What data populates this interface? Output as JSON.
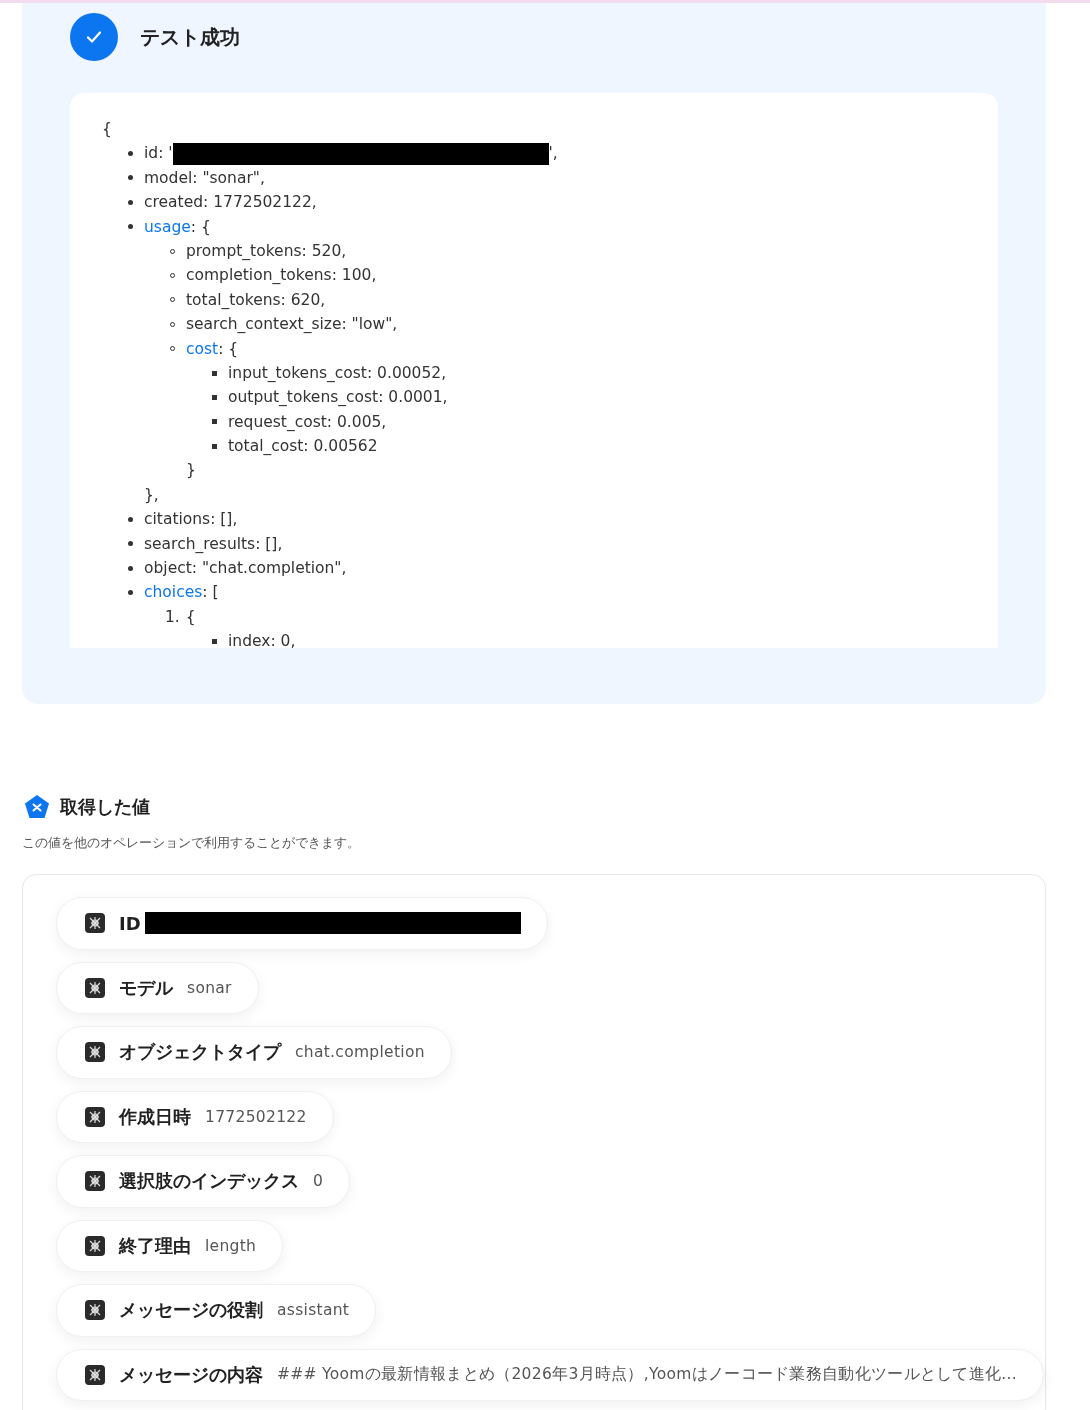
{
  "result": {
    "title": "テスト成功",
    "success": true,
    "code": {
      "open": "{",
      "items": [
        {
          "text": "id: '",
          "redacted": true,
          "after": "',"
        },
        {
          "text": "model: \"sonar\","
        },
        {
          "text": "created: 1772502122,"
        },
        {
          "key": "usage",
          "text": ": {",
          "close": "},",
          "children": [
            {
              "text": "prompt_tokens: 520,"
            },
            {
              "text": "completion_tokens: 100,"
            },
            {
              "text": "total_tokens: 620,"
            },
            {
              "text": "search_context_size: \"low\","
            },
            {
              "key": "cost",
              "text": ": {",
              "close": "}",
              "children": [
                {
                  "text": "input_tokens_cost: 0.00052,"
                },
                {
                  "text": "output_tokens_cost: 0.0001,"
                },
                {
                  "text": "request_cost: 0.005,"
                },
                {
                  "text": "total_cost: 0.00562"
                }
              ]
            }
          ]
        },
        {
          "text": "citations: [],"
        },
        {
          "text": "search_results: [],"
        },
        {
          "text": "object: \"chat.completion\","
        },
        {
          "key": "choices",
          "text": ": [",
          "ordered_children": [
            {
              "marker": "1.",
              "text": "{",
              "children": [
                {
                  "text": "index: 0,"
                }
              ]
            }
          ]
        }
      ]
    }
  },
  "values": {
    "title": "取得した値",
    "description": "この値を他のオペレーションで利用することができます。",
    "chips": [
      {
        "label": "ID",
        "redacted": true
      },
      {
        "label": "モデル",
        "value": "sonar"
      },
      {
        "label": "オブジェクトタイプ",
        "value": "chat.completion"
      },
      {
        "label": "作成日時",
        "value": "1772502122"
      },
      {
        "label": "選択肢のインデックス",
        "value": "0"
      },
      {
        "label": "終了理由",
        "value": "length"
      },
      {
        "label": "メッセージの役割",
        "value": "assistant"
      },
      {
        "label": "メッセージの内容",
        "value": "### Yoomの最新情報まとめ（2026年3月時点）,Yoomはノーコード業務自動化ツールとして進化..."
      }
    ]
  }
}
